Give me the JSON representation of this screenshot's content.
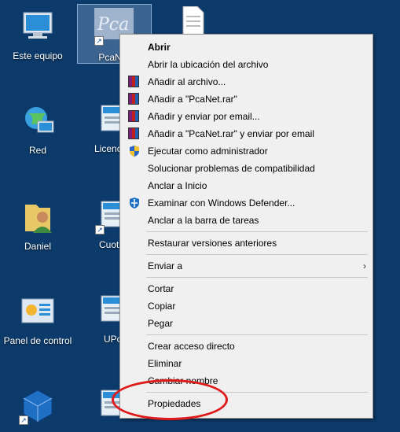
{
  "desktop": {
    "icons_left": [
      {
        "label": "Este equipo",
        "icon": "computer-icon"
      },
      {
        "label": "Red",
        "icon": "network-icon"
      },
      {
        "label": "Daniel",
        "icon": "user-folder-icon"
      },
      {
        "label": "Panel de control",
        "icon": "control-panel-icon"
      },
      {
        "label": "",
        "icon": "virtualbox-icon"
      }
    ],
    "icons_mid": [
      {
        "label": "PcaNet",
        "icon": "pcanet-icon"
      },
      {
        "label": "Licenc",
        "icon": "installer-icon"
      },
      {
        "label": "Cuot",
        "icon": "installer-icon"
      },
      {
        "label": "UPc",
        "icon": "installer-icon"
      },
      {
        "label": "",
        "icon": "installer-icon"
      }
    ],
    "pcanet_logo_text": "Pca"
  },
  "context_menu": {
    "items": [
      {
        "label": "Abrir",
        "bold": true,
        "icon": ""
      },
      {
        "label": "Abrir la ubicación del archivo",
        "icon": ""
      },
      {
        "label": "Añadir al archivo...",
        "icon": "winrar-icon"
      },
      {
        "label": "Añadir a \"PcaNet.rar\"",
        "icon": "winrar-icon"
      },
      {
        "label": "Añadir y enviar por email...",
        "icon": "winrar-icon"
      },
      {
        "label": "Añadir a \"PcaNet.rar\" y enviar por email",
        "icon": "winrar-icon"
      },
      {
        "label": "Ejecutar como administrador",
        "icon": "uac-shield-icon"
      },
      {
        "label": "Solucionar problemas de compatibilidad",
        "icon": ""
      },
      {
        "label": "Anclar a Inicio",
        "icon": ""
      },
      {
        "label": "Examinar con Windows Defender...",
        "icon": "defender-icon"
      },
      {
        "label": "Anclar a la barra de tareas",
        "icon": ""
      },
      {
        "label": "Restaurar versiones anteriores",
        "icon": ""
      },
      {
        "label": "Enviar a",
        "icon": "",
        "submenu": true
      },
      {
        "label": "Cortar",
        "icon": ""
      },
      {
        "label": "Copiar",
        "icon": ""
      },
      {
        "label": "Pegar",
        "icon": ""
      },
      {
        "label": "Crear acceso directo",
        "icon": ""
      },
      {
        "label": "Eliminar",
        "icon": ""
      },
      {
        "label": "Cambiar nombre",
        "icon": ""
      },
      {
        "label": "Propiedades",
        "icon": ""
      }
    ],
    "submenu_arrow": "›"
  },
  "colors": {
    "desktop_bg": "#0c3b6b",
    "menu_bg": "#f0f0f0",
    "highlight_ring": "#e01b1b"
  }
}
